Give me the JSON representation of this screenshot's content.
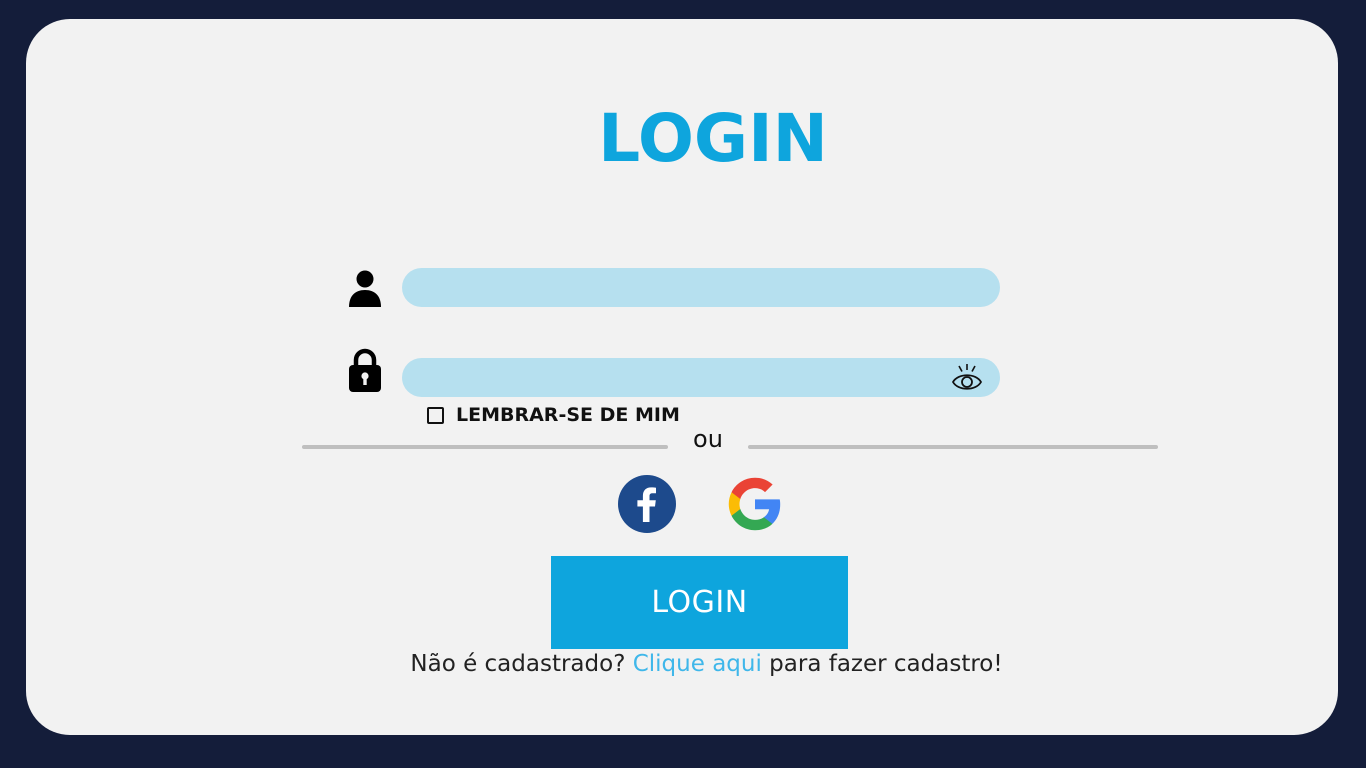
{
  "colors": {
    "background": "#141d3a",
    "card": "#f2f2f2",
    "accent": "#0ea5dd",
    "field": "#b6e0ef",
    "link": "#3fb7ea",
    "facebook": "#1d4a8c"
  },
  "title": "LOGIN",
  "form": {
    "username": {
      "icon": "user-icon",
      "value": "",
      "placeholder": ""
    },
    "password": {
      "icon": "lock-icon",
      "value": "",
      "placeholder": "",
      "toggle_icon": "eye-icon"
    },
    "remember_me": {
      "label": "LEMBRAR-SE DE MIM",
      "checked": false
    }
  },
  "divider": {
    "text": "ou"
  },
  "social": [
    {
      "name": "facebook",
      "icon": "facebook-icon"
    },
    {
      "name": "google",
      "icon": "google-icon"
    }
  ],
  "login_button": {
    "label": "LOGIN"
  },
  "signup": {
    "prefix": "Não é cadastrado? ",
    "link": "Clique aqui",
    "suffix": " para fazer cadastro!"
  }
}
